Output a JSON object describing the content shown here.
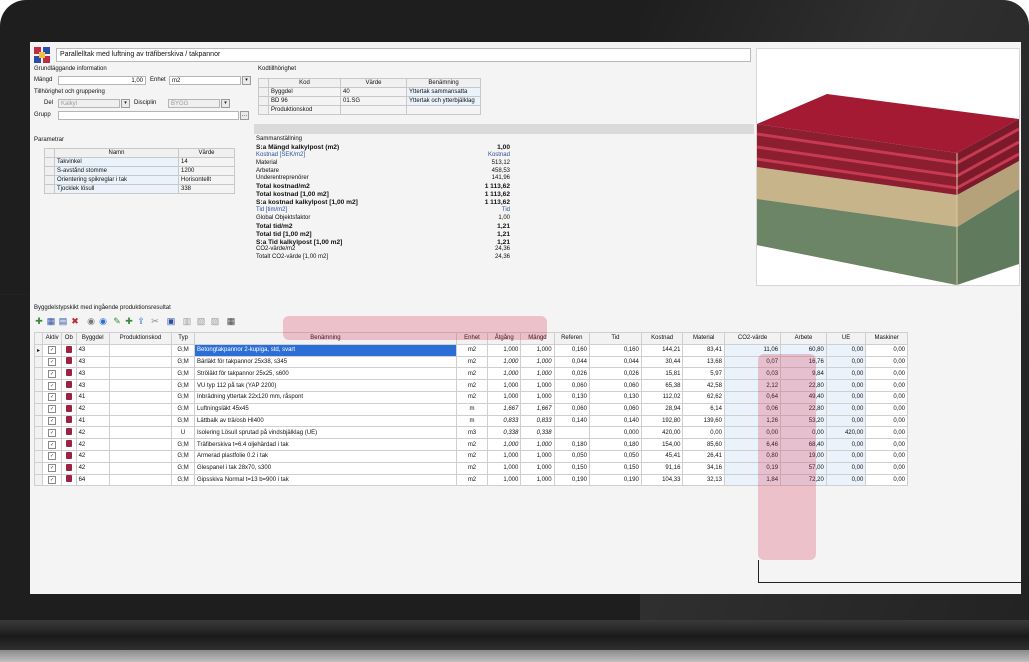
{
  "header": {
    "title": "Parallelltak med luftning av träfiberskiva / takpannor"
  },
  "basic": {
    "section": "Grundläggande information",
    "qty_label": "Mängd",
    "qty_value": "1,00",
    "unit_label": "Enhet",
    "unit_value": "m2",
    "belong_label": "Tillhörighet och gruppering",
    "del_label": "Del",
    "del_value": "Kalkyl",
    "disc_label": "Disciplin",
    "disc_value": "BYGG",
    "group_label": "Grupp",
    "group_value": ""
  },
  "codes": {
    "section": "Kodtillhörighet",
    "headers": [
      "Kod",
      "Värde",
      "Benämning"
    ],
    "rows": [
      [
        "Byggdel",
        "40",
        "Yttertak sammansatta"
      ],
      [
        "BD 96",
        "01.SG",
        "Yttertak och ytterbjälklag"
      ],
      [
        "Produktionskod",
        "",
        ""
      ]
    ]
  },
  "params": {
    "section": "Parametrar",
    "headers": [
      "Namn",
      "Värde"
    ],
    "rows": [
      [
        "Takvinkel",
        "14"
      ],
      [
        "S-avstånd stomme",
        "1200"
      ],
      [
        "Orientering spikreglar i tak",
        "Horisontellt"
      ],
      [
        "Tjocklek lösull",
        "338"
      ]
    ]
  },
  "summary": {
    "section": "Sammanställning",
    "rows": [
      {
        "label": "S:a Mängd kalkylpost (m2)",
        "value": "1,00"
      },
      {
        "label": "Kostnad [SEK/m2]",
        "value": "Kostnad"
      },
      {
        "label": "Material",
        "value": "513,12"
      },
      {
        "label": "Arbetare",
        "value": "458,53"
      },
      {
        "label": "Underentreprenörer",
        "value": "141,96"
      },
      {
        "label": "Total kostnad/m2",
        "value": "1 113,62"
      },
      {
        "label": "Total kostnad [1,00 m2]",
        "value": "1 113,62"
      },
      {
        "label": "S:a kostnad kalkylpost [1,00 m2]",
        "value": "1 113,62"
      },
      {
        "label": "Tid [tim/m2]",
        "value": "Tid"
      },
      {
        "label": "Global Objektsfaktor",
        "value": "1,00"
      },
      {
        "label": "Total tid/m2",
        "value": "1,21"
      },
      {
        "label": "Total tid [1,00 m2]",
        "value": "1,21"
      },
      {
        "label": "S:a Tid kalkylpost [1,00 m2]",
        "value": "1,21"
      },
      {
        "label": "CO2-värde/m2",
        "value": "24,36"
      },
      {
        "label": "Totalt CO2-värde [1,00 m2]",
        "value": "24,36"
      }
    ]
  },
  "grid": {
    "title": "Byggdelstypskikt med ingående produktionsresultat",
    "headers": [
      "Aktiv",
      "Ob",
      "Byggdel",
      "Produktionskod",
      "Typ",
      "Benämning",
      "Enhet",
      "Åtgång",
      "Mängd",
      "Referen",
      "Tid",
      "Kostnad",
      "Material",
      "CO2-värde",
      "Arbete",
      "UE",
      "Maskiner"
    ],
    "rows": [
      [
        "43",
        "",
        "G;M",
        "Betongtakpannor 2-kupiga, std, svart",
        "m2",
        "1,000",
        "1,000",
        "0,160",
        "0,160",
        "144,21",
        "83,41",
        "11,06",
        "60,80",
        "0,00",
        "0,00"
      ],
      [
        "43",
        "",
        "G;M",
        "Bärläkt för takpannor 25x38, s345",
        "m2",
        "1,000",
        "1,000",
        "0,044",
        "0,044",
        "30,44",
        "13,68",
        "0,07",
        "16,76",
        "0,00",
        "0,00"
      ],
      [
        "43",
        "",
        "G;M",
        "Ströläkt för takpannor 25x25, s600",
        "m2",
        "1,000",
        "1,000",
        "0,026",
        "0,026",
        "15,81",
        "5,97",
        "0,03",
        "9,84",
        "0,00",
        "0,00"
      ],
      [
        "43",
        "",
        "G;M",
        "VU typ 112 på tak  (YAP 2200)",
        "m2",
        "1,000",
        "1,000",
        "0,060",
        "0,060",
        "65,38",
        "42,58",
        "2,12",
        "22,80",
        "0,00",
        "0,00"
      ],
      [
        "41",
        "",
        "G;M",
        "Inbrädning yttertak 22x120 mm, råspont",
        "m2",
        "1,000",
        "1,000",
        "0,130",
        "0,130",
        "112,02",
        "62,62",
        "0,64",
        "49,40",
        "0,00",
        "0,00"
      ],
      [
        "42",
        "",
        "G;M",
        "Luftningsläkt 45x45",
        "m",
        "1,667",
        "1,667",
        "0,060",
        "0,060",
        "28,94",
        "6,14",
        "0,06",
        "22,80",
        "0,00",
        "0,00"
      ],
      [
        "41",
        "",
        "G;M",
        "Lättbalk av trä/osb HI400",
        "m",
        "0,833",
        "0,833",
        "0,140",
        "0,140",
        "192,80",
        "139,60",
        "1,26",
        "53,20",
        "0,00",
        "0,00"
      ],
      [
        "42",
        "",
        "U",
        "Isolering Lösull sprutad på vindsbjälklag (UE)",
        "m3",
        "0,338",
        "0,338",
        "",
        "0,000",
        "420,00",
        "0,00",
        "0,00",
        "0,00",
        "420,00",
        "0,00"
      ],
      [
        "42",
        "",
        "G;M",
        "Träfiberskiva t=6.4 oljehärdad i tak",
        "m2",
        "1,000",
        "1,000",
        "0,180",
        "0,180",
        "154,00",
        "85,60",
        "6,46",
        "68,40",
        "0,00",
        "0,00"
      ],
      [
        "42",
        "",
        "G;M",
        "Armerad plastfolie 0.2 i tak",
        "m2",
        "1,000",
        "1,000",
        "0,050",
        "0,050",
        "45,41",
        "26,41",
        "0,80",
        "19,00",
        "0,00",
        "0,00"
      ],
      [
        "42",
        "",
        "G;M",
        "Glespanel i tak 28x70, s300",
        "m2",
        "1,000",
        "1,000",
        "0,150",
        "0,150",
        "91,16",
        "34,16",
        "0,19",
        "57,00",
        "0,00",
        "0,00"
      ],
      [
        "64",
        "",
        "G;M",
        "Gipsskiva Normal t=13 b=900 i tak",
        "m2",
        "1,000",
        "1,000",
        "0,190",
        "0,190",
        "104,33",
        "32,13",
        "1,84",
        "72,20",
        "0,00",
        "0,00"
      ]
    ]
  },
  "icons": [
    "logo-icon",
    "dropdown-icon",
    "ellipsis-icon",
    "row-pointer-icon",
    "checkbox-icon",
    "object-icon",
    "toolbar-icons",
    "roof-3d-render"
  ],
  "colors": {
    "highlight": "#d62846",
    "selection": "#2b6fd6",
    "roof_tile": "#b0203a"
  }
}
